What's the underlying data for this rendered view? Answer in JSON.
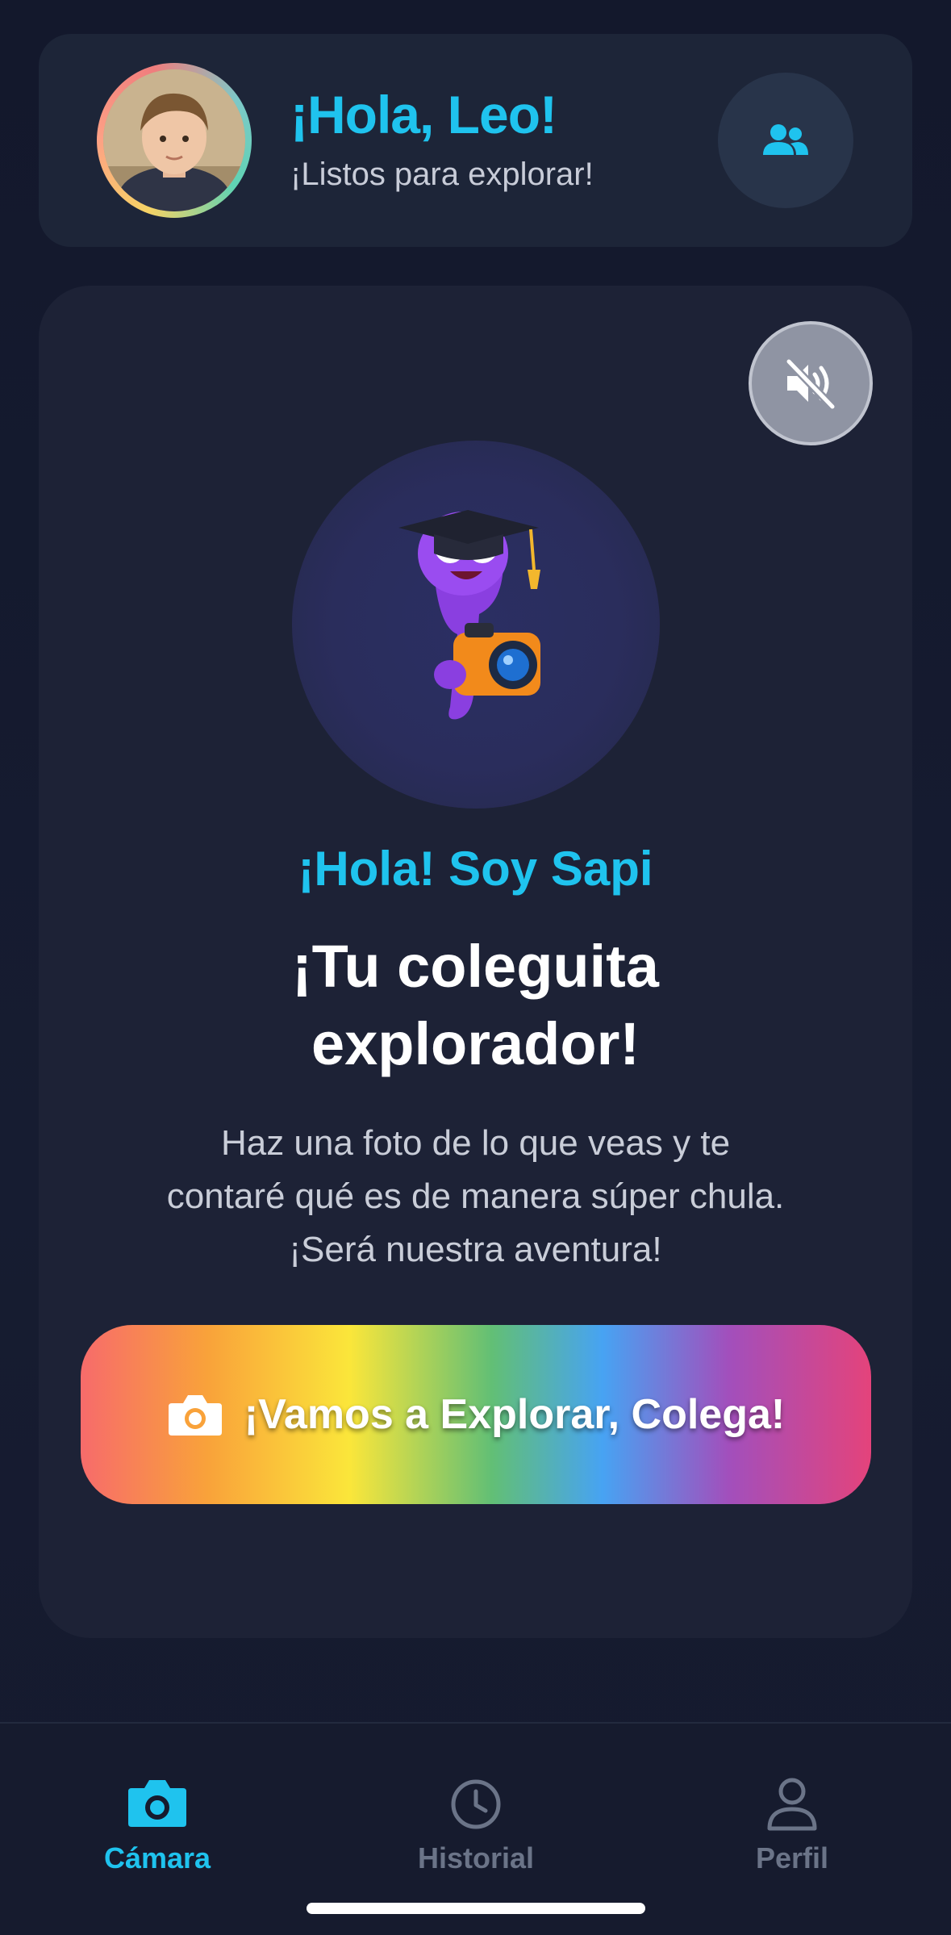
{
  "header": {
    "greeting": "¡Hola, Leo!",
    "subtitle": "¡Listos para explorar!",
    "avatar": "child-avatar",
    "action_icon": "users-icon"
  },
  "main": {
    "mute_icon": "volume-mute-icon",
    "mascot": "graduate-mascot-with-camera",
    "intro": "¡Hola! Soy Sapi",
    "headline_line1": "¡Tu coleguita",
    "headline_line2": "explorador!",
    "description": "Haz una foto de lo que veas y te contaré qué es de manera súper chula. ¡Será nuestra aventura!",
    "cta": {
      "icon": "camera-icon",
      "label": "¡Vamos a Explorar, Colega!"
    }
  },
  "nav": {
    "items": [
      {
        "label": "Cámara",
        "icon": "camera-icon",
        "active": true
      },
      {
        "label": "Historial",
        "icon": "clock-icon",
        "active": false
      },
      {
        "label": "Perfil",
        "icon": "user-icon",
        "active": false
      }
    ]
  },
  "colors": {
    "accent": "#1fc3ee",
    "inactive": "#6b7488",
    "background": "#141a2e",
    "card": "#1d2236"
  }
}
